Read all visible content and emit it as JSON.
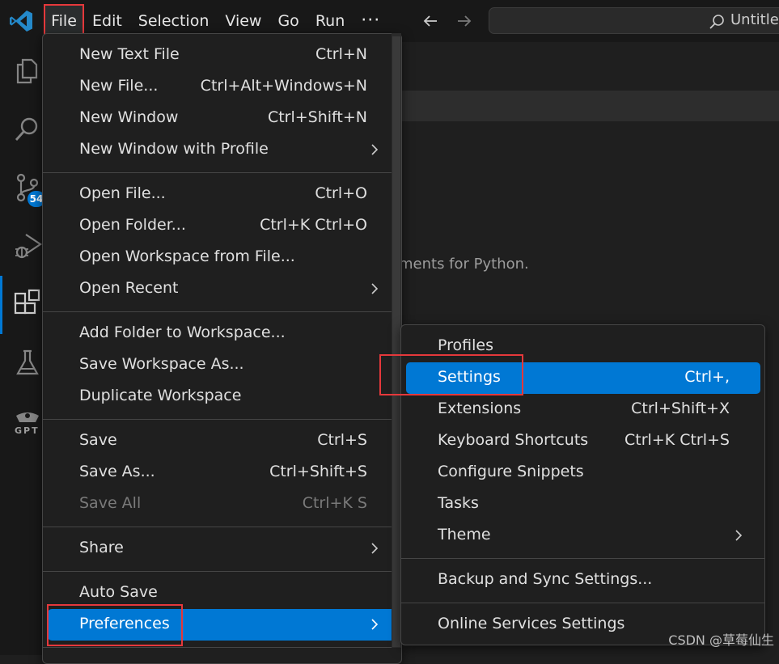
{
  "menubar": {
    "items": [
      "File",
      "Edit",
      "Selection",
      "View",
      "Go",
      "Run",
      "···"
    ]
  },
  "command_center": {
    "text": "Untitled"
  },
  "activity_bar": {
    "badge_count": "54",
    "gpt_label": "GPT"
  },
  "background_text": "ments for Python.",
  "file_menu": {
    "items": [
      {
        "label": "New Text File",
        "shortcut": "Ctrl+N"
      },
      {
        "label": "New File...",
        "shortcut": "Ctrl+Alt+Windows+N"
      },
      {
        "label": "New Window",
        "shortcut": "Ctrl+Shift+N"
      },
      {
        "label": "New Window with Profile",
        "shortcut": ""
      },
      {
        "label": "Open File...",
        "shortcut": "Ctrl+O"
      },
      {
        "label": "Open Folder...",
        "shortcut": "Ctrl+K Ctrl+O"
      },
      {
        "label": "Open Workspace from File...",
        "shortcut": ""
      },
      {
        "label": "Open Recent",
        "shortcut": ""
      },
      {
        "label": "Add Folder to Workspace...",
        "shortcut": ""
      },
      {
        "label": "Save Workspace As...",
        "shortcut": ""
      },
      {
        "label": "Duplicate Workspace",
        "shortcut": ""
      },
      {
        "label": "Save",
        "shortcut": "Ctrl+S"
      },
      {
        "label": "Save As...",
        "shortcut": "Ctrl+Shift+S"
      },
      {
        "label": "Save All",
        "shortcut": "Ctrl+K S"
      },
      {
        "label": "Share",
        "shortcut": ""
      },
      {
        "label": "Auto Save",
        "shortcut": ""
      },
      {
        "label": "Preferences",
        "shortcut": ""
      }
    ]
  },
  "preferences_menu": {
    "items": [
      {
        "label": "Profiles",
        "shortcut": ""
      },
      {
        "label": "Settings",
        "shortcut": "Ctrl+,"
      },
      {
        "label": "Extensions",
        "shortcut": "Ctrl+Shift+X"
      },
      {
        "label": "Keyboard Shortcuts",
        "shortcut": "Ctrl+K Ctrl+S"
      },
      {
        "label": "Configure Snippets",
        "shortcut": ""
      },
      {
        "label": "Tasks",
        "shortcut": ""
      },
      {
        "label": "Theme",
        "shortcut": ""
      },
      {
        "label": "Backup and Sync Settings...",
        "shortcut": ""
      },
      {
        "label": "Online Services Settings",
        "shortcut": ""
      }
    ]
  },
  "watermark": "CSDN @草莓仙生",
  "colors": {
    "accent": "#0078d4",
    "annotation": "#e5383b",
    "menu_bg": "#1f1f1f"
  }
}
